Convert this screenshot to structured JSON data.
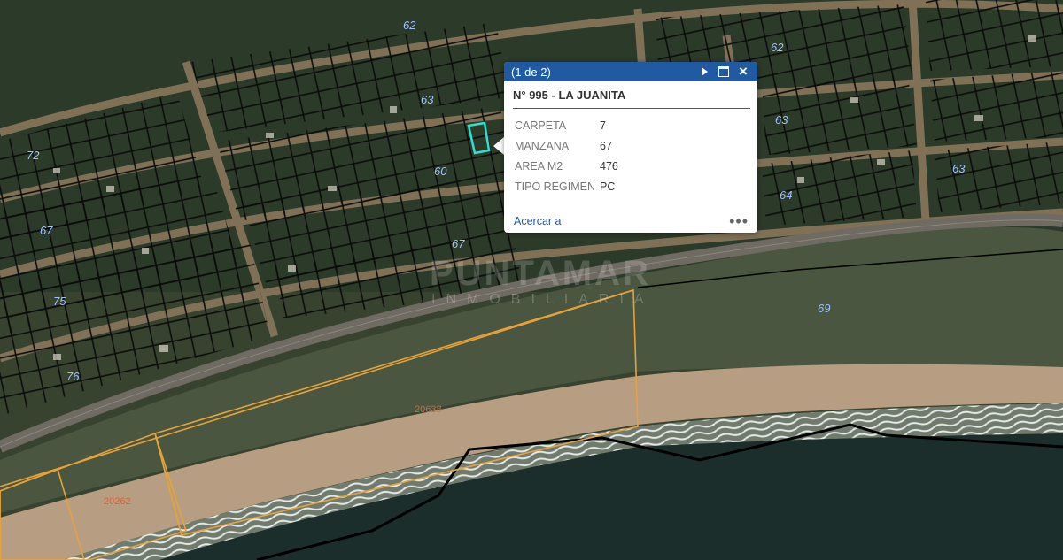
{
  "map": {
    "block_labels": [
      "62",
      "63",
      "60",
      "72",
      "67",
      "63",
      "64",
      "63",
      "62",
      "67",
      "69",
      "75",
      "76"
    ],
    "parcel_labels": [
      "20638",
      "20262"
    ],
    "watermark": {
      "line1": "PUNTAMAR",
      "line2": "INMOBILIARIA"
    },
    "colors": {
      "ocean": "#1c2e2b",
      "beach": "#b79d82",
      "vegetation": "#2f3d2c",
      "grid": "#0b0b0b",
      "highlight": "#2fe0d0",
      "parcel": "#e8a23a"
    }
  },
  "popup": {
    "counter": "(1 de 2)",
    "title": "N° 995 - LA JUANITA",
    "attributes": [
      {
        "key": "CARPETA",
        "value": "7"
      },
      {
        "key": "MANZANA",
        "value": "67"
      },
      {
        "key": "AREA M2",
        "value": "476"
      },
      {
        "key": "TIPO REGIMEN",
        "value": "PC"
      }
    ],
    "zoom_label": "Acercar a",
    "more_label": "•••",
    "icons": {
      "next": "play-icon",
      "maximize": "maximize-icon",
      "close": "close-icon"
    }
  }
}
